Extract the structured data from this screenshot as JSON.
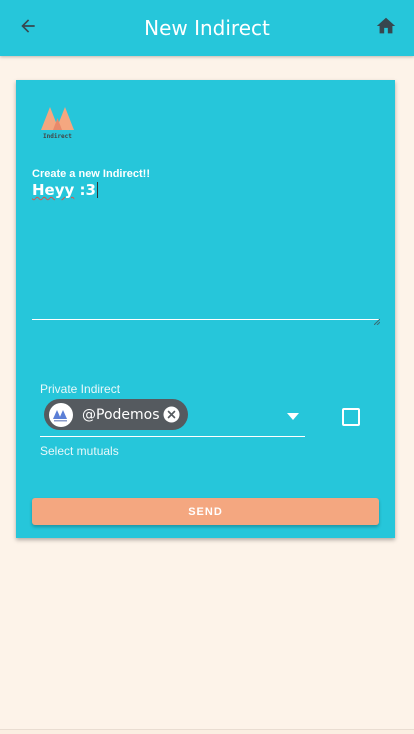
{
  "app_bar": {
    "title": "New Indirect",
    "back_icon": "arrow-left-icon",
    "home_icon": "home-icon",
    "color": "#26c6da"
  },
  "card": {
    "logo_text": "Indirect",
    "compose": {
      "label": "Create a new Indirect!!",
      "value_misspelled": "Heyy",
      "value_rest": " :3"
    },
    "private": {
      "label": "Private Indirect",
      "selected_chip": "@Podemos",
      "helper": "Select mutuals",
      "checkbox_checked": false
    },
    "send_label": "SEND",
    "send_color": "#f4a780"
  },
  "colors": {
    "background": "#fdf3e9",
    "accent": "#26c6da",
    "chip": "#555a5f"
  }
}
